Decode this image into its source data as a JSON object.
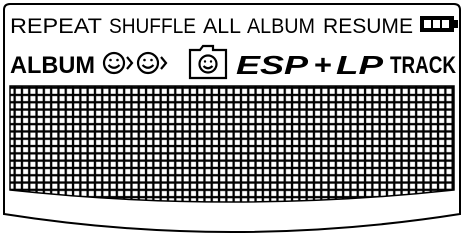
{
  "display": {
    "row1": {
      "repeat": "REPEAT",
      "shuffle": "SHUFFLE",
      "all": "ALL",
      "album": "ALBUM",
      "resume": "RESUME"
    },
    "row2": {
      "album": "ALBUM",
      "esp": "ESP",
      "plus": "+",
      "lp": "LP",
      "track": "TRACK"
    }
  },
  "icons": [
    "battery-icon",
    "smiley-arrow-icon",
    "smiley-arrow-icon",
    "smiley-folder-icon"
  ],
  "colors": {
    "segment": "#000000",
    "background": "#ffffff"
  }
}
